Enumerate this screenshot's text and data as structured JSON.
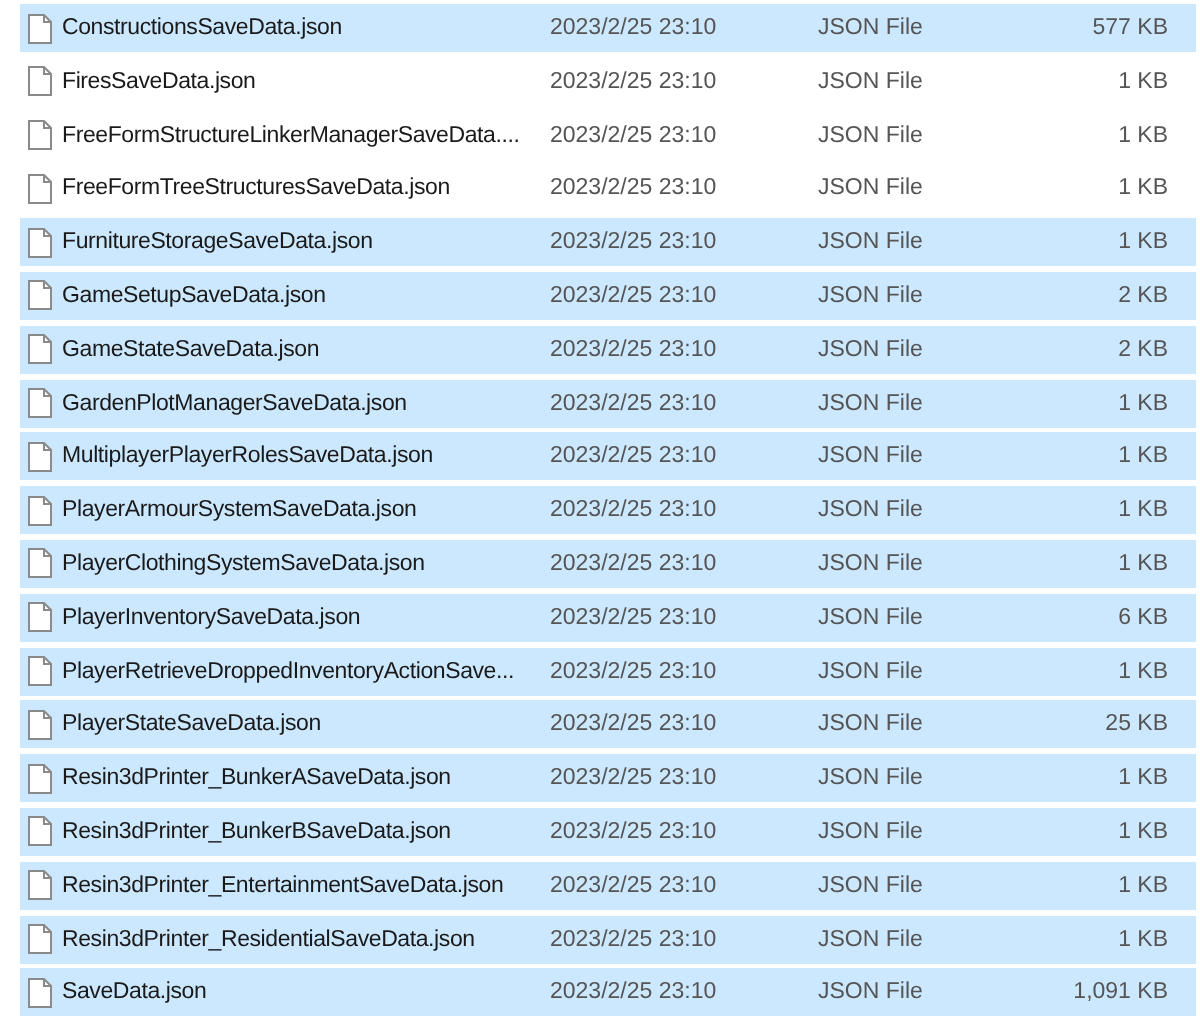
{
  "files": [
    {
      "name": "ConstructionsSaveData.json",
      "date": "2023/2/25 23:10",
      "type": "JSON File",
      "size": "577 KB",
      "selected": true
    },
    {
      "name": "FiresSaveData.json",
      "date": "2023/2/25 23:10",
      "type": "JSON File",
      "size": "1 KB",
      "selected": false
    },
    {
      "name": "FreeFormStructureLinkerManagerSaveData....",
      "date": "2023/2/25 23:10",
      "type": "JSON File",
      "size": "1 KB",
      "selected": false
    },
    {
      "name": "FreeFormTreeStructuresSaveData.json",
      "date": "2023/2/25 23:10",
      "type": "JSON File",
      "size": "1 KB",
      "selected": false
    },
    {
      "name": "FurnitureStorageSaveData.json",
      "date": "2023/2/25 23:10",
      "type": "JSON File",
      "size": "1 KB",
      "selected": true
    },
    {
      "name": "GameSetupSaveData.json",
      "date": "2023/2/25 23:10",
      "type": "JSON File",
      "size": "2 KB",
      "selected": true
    },
    {
      "name": "GameStateSaveData.json",
      "date": "2023/2/25 23:10",
      "type": "JSON File",
      "size": "2 KB",
      "selected": true
    },
    {
      "name": "GardenPlotManagerSaveData.json",
      "date": "2023/2/25 23:10",
      "type": "JSON File",
      "size": "1 KB",
      "selected": true
    },
    {
      "name": "MultiplayerPlayerRolesSaveData.json",
      "date": "2023/2/25 23:10",
      "type": "JSON File",
      "size": "1 KB",
      "selected": true
    },
    {
      "name": "PlayerArmourSystemSaveData.json",
      "date": "2023/2/25 23:10",
      "type": "JSON File",
      "size": "1 KB",
      "selected": true
    },
    {
      "name": "PlayerClothingSystemSaveData.json",
      "date": "2023/2/25 23:10",
      "type": "JSON File",
      "size": "1 KB",
      "selected": true
    },
    {
      "name": "PlayerInventorySaveData.json",
      "date": "2023/2/25 23:10",
      "type": "JSON File",
      "size": "6 KB",
      "selected": true
    },
    {
      "name": "PlayerRetrieveDroppedInventoryActionSave...",
      "date": "2023/2/25 23:10",
      "type": "JSON File",
      "size": "1 KB",
      "selected": true
    },
    {
      "name": "PlayerStateSaveData.json",
      "date": "2023/2/25 23:10",
      "type": "JSON File",
      "size": "25 KB",
      "selected": true
    },
    {
      "name": "Resin3dPrinter_BunkerASaveData.json",
      "date": "2023/2/25 23:10",
      "type": "JSON File",
      "size": "1 KB",
      "selected": true
    },
    {
      "name": "Resin3dPrinter_BunkerBSaveData.json",
      "date": "2023/2/25 23:10",
      "type": "JSON File",
      "size": "1 KB",
      "selected": true
    },
    {
      "name": "Resin3dPrinter_EntertainmentSaveData.json",
      "date": "2023/2/25 23:10",
      "type": "JSON File",
      "size": "1 KB",
      "selected": true
    },
    {
      "name": "Resin3dPrinter_ResidentialSaveData.json",
      "date": "2023/2/25 23:10",
      "type": "JSON File",
      "size": "1 KB",
      "selected": true
    },
    {
      "name": "SaveData.json",
      "date": "2023/2/25 23:10",
      "type": "JSON File",
      "size": "1,091 KB",
      "selected": true
    }
  ]
}
